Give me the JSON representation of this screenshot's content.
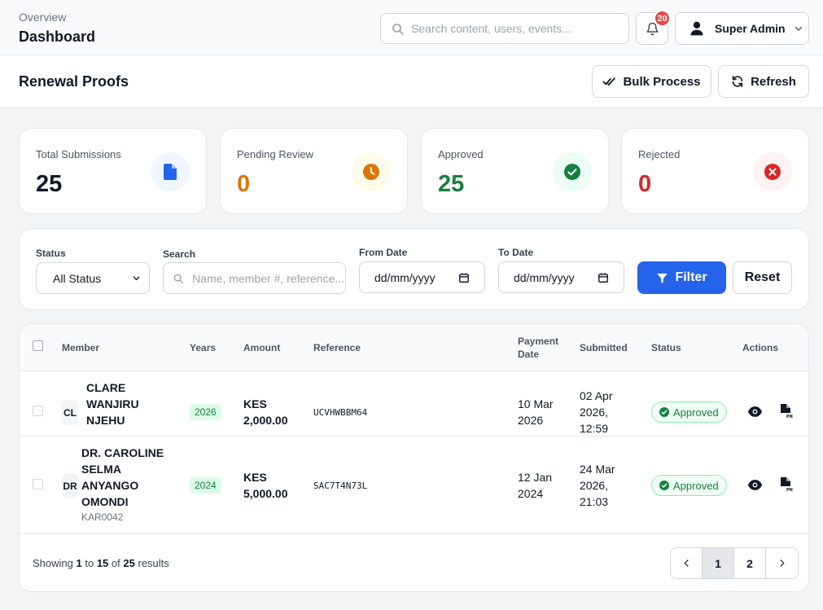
{
  "header": {
    "breadcrumb": "Overview",
    "title": "Dashboard",
    "search_placeholder": "Search content, users, events...",
    "notification_count": "20",
    "user_name": "Super Admin"
  },
  "section": {
    "title": "Renewal Proofs",
    "bulk_label": "Bulk Process",
    "refresh_label": "Refresh"
  },
  "stats": [
    {
      "label": "Total Submissions",
      "value": "25",
      "color": "#111827",
      "icon": "document-icon"
    },
    {
      "label": "Pending Review",
      "value": "0",
      "color": "#d97706",
      "icon": "clock-icon"
    },
    {
      "label": "Approved",
      "value": "25",
      "color": "#15803d",
      "icon": "check-circle-icon"
    },
    {
      "label": "Rejected",
      "value": "0",
      "color": "#dc2626",
      "icon": "x-circle-icon"
    }
  ],
  "filters": {
    "status_label": "Status",
    "status_value": "All Status",
    "search_label": "Search",
    "search_placeholder": "Name, member #, reference...",
    "from_label": "From Date",
    "from_placeholder": "dd/mm/yyyy",
    "to_label": "To Date",
    "to_placeholder": "dd/mm/yyyy",
    "filter_button": "Filter",
    "reset_button": "Reset"
  },
  "table": {
    "columns": {
      "member": "Member",
      "years": "Years",
      "amount": "Amount",
      "reference": "Reference",
      "payment_date_1": "Payment",
      "payment_date_2": "Date",
      "submitted": "Submitted",
      "status": "Status",
      "actions": "Actions"
    },
    "rows": [
      {
        "initials": "CL",
        "name_lines": [
          "CLARE",
          "WANJIRU",
          "NJEHU"
        ],
        "member_no": "",
        "year": "2026",
        "amount_1": "KES",
        "amount_2": "2,000.00",
        "reference": "UCVHWBBM64",
        "payment_1": "10 Mar",
        "payment_2": "2026",
        "submitted_1": "02 Apr",
        "submitted_2": "2026,",
        "submitted_3": "12:59",
        "status": "Approved"
      },
      {
        "initials": "DR",
        "name_lines": [
          "DR. CAROLINE",
          "SELMA",
          "ANYANGO",
          "OMONDI"
        ],
        "member_no": "KAR0042",
        "year": "2024",
        "amount_1": "KES",
        "amount_2": "5,000.00",
        "reference": "SAC7T4N73L",
        "payment_1": "12 Jan",
        "payment_2": "2024",
        "submitted_1": "24 Mar",
        "submitted_2": "2026,",
        "submitted_3": "21:03",
        "status": "Approved"
      }
    ]
  },
  "pagination": {
    "prefix": "Showing",
    "from": "1",
    "to_word": "to",
    "to": "15",
    "of_word": "of",
    "total": "25",
    "suffix": "results",
    "pages": [
      "1",
      "2"
    ]
  }
}
